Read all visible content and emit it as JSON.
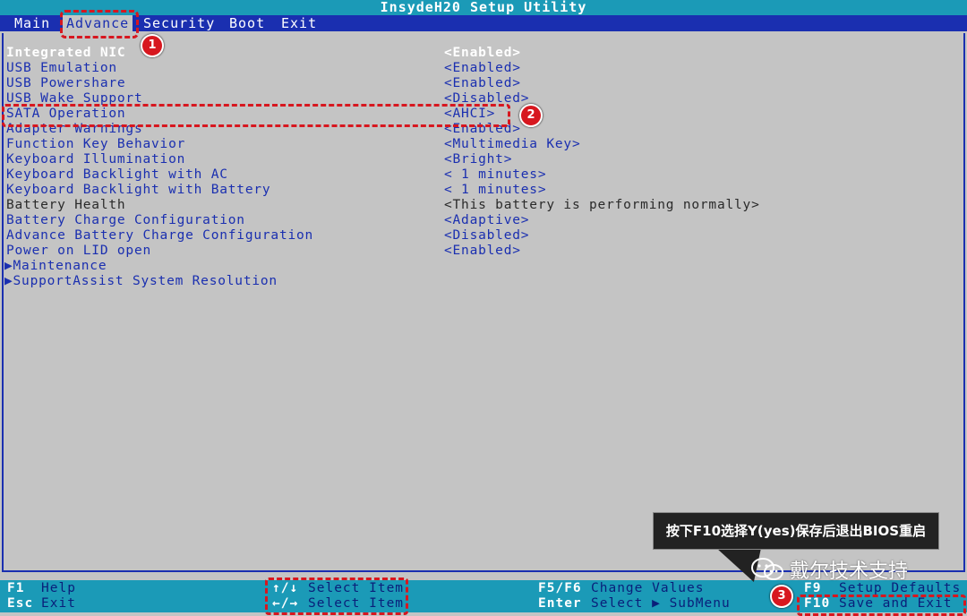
{
  "window": {
    "title": "InsydeH20 Setup Utility"
  },
  "menu": {
    "items": [
      {
        "label": "Main"
      },
      {
        "label": "Advance"
      },
      {
        "label": "Security"
      },
      {
        "label": "Boot"
      },
      {
        "label": "Exit"
      }
    ],
    "active": "Advance"
  },
  "settings": [
    {
      "label": "Integrated NIC",
      "value": "<Enabled>"
    },
    {
      "label": "USB Emulation",
      "value": "<Enabled>"
    },
    {
      "label": "USB Powershare",
      "value": "<Enabled>"
    },
    {
      "label": "USB Wake Support",
      "value": "<Disabled>"
    },
    {
      "label": "SATA Operation",
      "value": "<AHCI>"
    },
    {
      "label": "Adapter Warnings",
      "value": "<Enabled>"
    },
    {
      "label": "Function Key Behavior",
      "value": "<Multimedia Key>"
    },
    {
      "label": "Keyboard Illumination",
      "value": "<Bright>"
    },
    {
      "label": "Keyboard Backlight with AC",
      "value": "< 1 minutes>"
    },
    {
      "label": "Keyboard Backlight with Battery",
      "value": "< 1 minutes>"
    },
    {
      "label": "Battery Health",
      "value": "<This battery is performing normally>"
    },
    {
      "label": "Battery Charge Configuration",
      "value": "<Adaptive>"
    },
    {
      "label": "Advance Battery Charge Configuration",
      "value": "<Disabled>"
    },
    {
      "label": "Power on LID open",
      "value": "<Enabled>"
    }
  ],
  "submenus": [
    {
      "label": "Maintenance"
    },
    {
      "label": "SupportAssist System Resolution"
    }
  ],
  "footer": {
    "f1_key": "F1",
    "f1_desc": "Help",
    "esc_key": "Esc",
    "esc_desc": "Exit",
    "updown_key": "↑/↓",
    "updown_desc": "Select Item",
    "leftright_key": "←/→",
    "leftright_desc": "Select Item",
    "f5f6_key": "F5/F6",
    "f5f6_desc": "Change Values",
    "enter_key": "Enter",
    "enter_desc": "Select ▶ SubMenu",
    "f9_key": "F9",
    "f9_desc": "Setup Defaults",
    "f10_key": "F10",
    "f10_desc": "Save and Exit"
  },
  "annotations": {
    "badge1": "1",
    "badge2": "2",
    "badge3": "3",
    "tooltip": "按下F10选择Y(yes)保存后退出BIOS重启",
    "watermark": "戴尔技术支持"
  },
  "colors": {
    "menubar": "#1a2fb0",
    "titlebar": "#1b9ab7",
    "background": "#c4c4c4",
    "highlight": "#d7171f"
  },
  "icons": {
    "submenu_arrow": "triangle-right-icon",
    "watermark_logo": "wechat-icon"
  }
}
